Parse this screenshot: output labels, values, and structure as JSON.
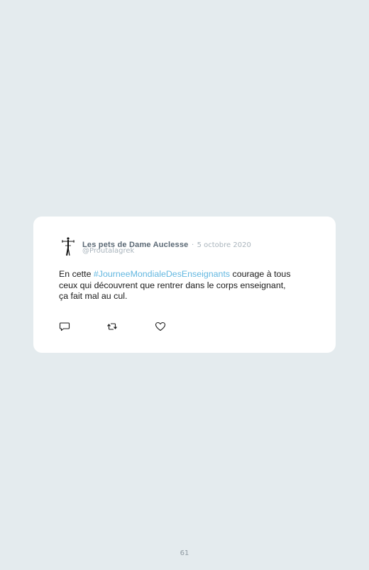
{
  "tweet": {
    "display_name": "Les pets de Dame Auclesse",
    "separator": "·",
    "date": "5 octobre 2020",
    "handle": "@Proutalagrek",
    "text_before": "En cette ",
    "hashtag": "#JourneeMondialeDesEnseignants",
    "text_line1_after": " courage à tous",
    "text_line2": "ceux qui découvrent que rentrer dans le corps enseignant,",
    "text_line3": "ça fait mal au cul.",
    "actions": {
      "reply_icon": "speech-bubble-icon",
      "retweet_icon": "retweet-icon",
      "like_icon": "heart-icon"
    },
    "avatar_icon": "stick-figure-icon"
  },
  "page": {
    "number": "61"
  },
  "colors": {
    "background": "#e4ebee",
    "card": "#ffffff",
    "hashtag": "#62b7e0",
    "muted": "#a9b4bc",
    "name": "#5a6874"
  }
}
